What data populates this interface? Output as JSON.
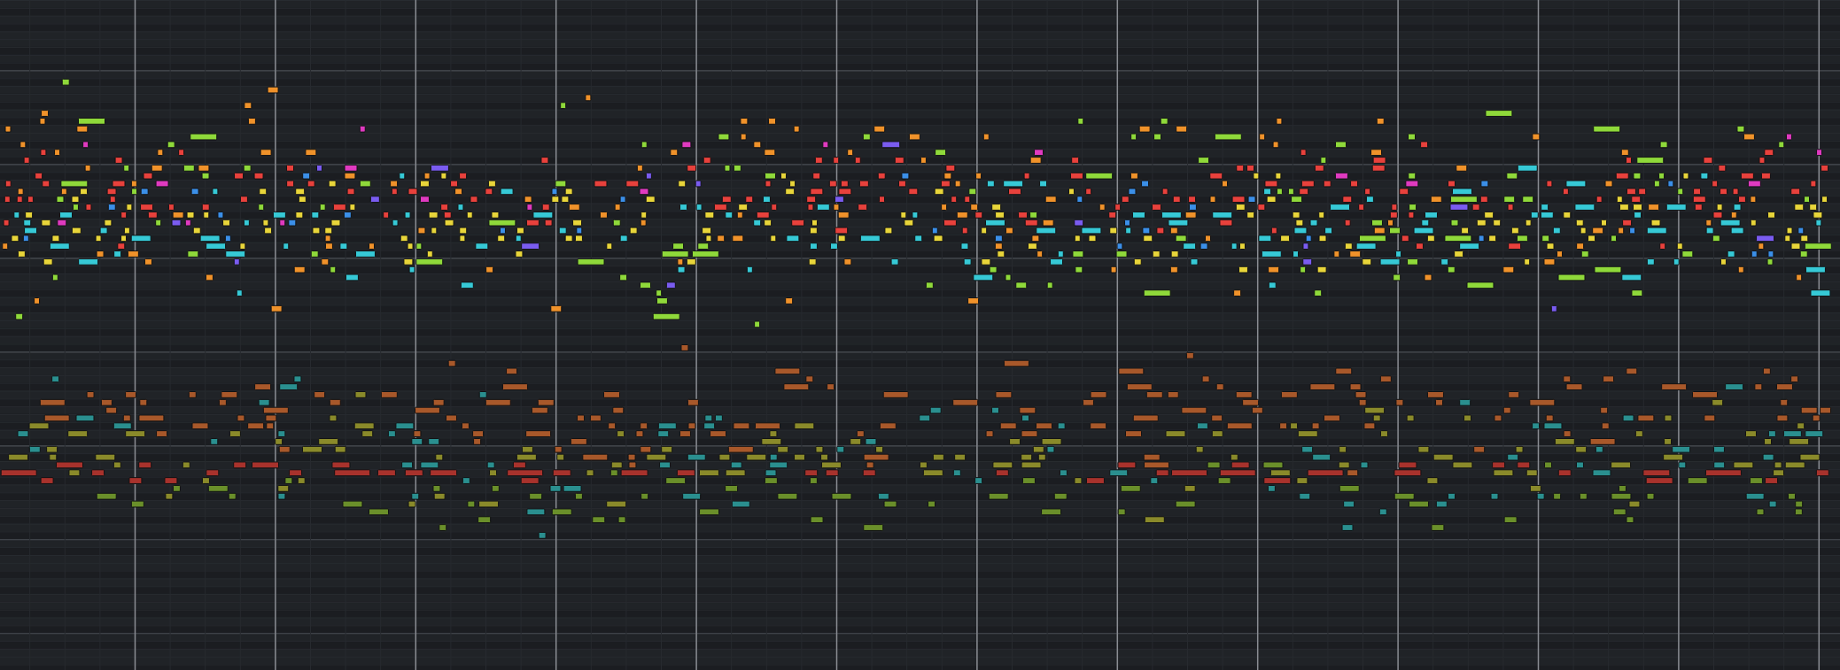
{
  "piano_roll": {
    "tracks": [
      {
        "color": "#e8413c"
      },
      {
        "color": "#e8d53a"
      },
      {
        "color": "#36c9d6"
      },
      {
        "color": "#f0922a"
      },
      {
        "color": "#8fd93a"
      },
      {
        "color": "#3b8fe8"
      },
      {
        "color": "#7a5cf0"
      },
      {
        "color": "#e03ac0"
      },
      {
        "color": "#a8582a"
      },
      {
        "color": "#8a8a2a"
      },
      {
        "color": "#2a8f8f"
      },
      {
        "color": "#a8322c"
      },
      {
        "color": "#6a8f2a"
      }
    ]
  }
}
